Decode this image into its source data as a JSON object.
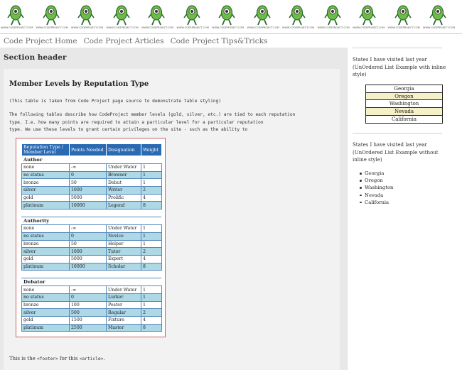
{
  "banner": {
    "logo_text": "WWW.CODEPROJECT.COM",
    "logo_count": 13
  },
  "nav": {
    "items": [
      "Code Project Home",
      "Code Project Articles",
      "Code Project Tips&Tricks"
    ]
  },
  "main": {
    "section_header": "Section header",
    "article_title": "Member Levels by Reputation Type",
    "note": "(This table is taken from Code Project page source to demonstrate table styling)",
    "description": [
      "The following tables describe how CodeProject member levels (gold, silver, etc.) are tied to each reputation",
      "type. I.e. how many points are required to attain a particular level for a particular reputation",
      "type. We use these levels to grant certain privileges on the site - such as the ability to"
    ],
    "footer": {
      "prefix": "This is the ",
      "code1": "<footer>",
      "middle": " for this ",
      "code2": "<article>",
      "suffix": "."
    }
  },
  "table": {
    "headers": [
      "Reputation Type / Member Level",
      "Points Needed",
      "Designation",
      "Weight"
    ],
    "groups": [
      {
        "name": "Author",
        "rows": [
          [
            "none",
            "-∞",
            "Under Water",
            "1"
          ],
          [
            "no status",
            "0",
            "Browser",
            "1"
          ],
          [
            "bronze",
            "50",
            "Debut",
            "1"
          ],
          [
            "silver",
            "1000",
            "Writer",
            "2"
          ],
          [
            "gold",
            "5000",
            "Prolific",
            "4"
          ],
          [
            "platinum",
            "10000",
            "Legend",
            "8"
          ]
        ]
      },
      {
        "name": "Authority",
        "rows": [
          [
            "none",
            "-∞",
            "Under Water",
            "1"
          ],
          [
            "no status",
            "0",
            "Novice",
            "1"
          ],
          [
            "bronze",
            "50",
            "Helper",
            "1"
          ],
          [
            "silver",
            "1000",
            "Tutor",
            "2"
          ],
          [
            "gold",
            "5000",
            "Expert",
            "4"
          ],
          [
            "platinum",
            "10000",
            "Scholar",
            "8"
          ]
        ]
      },
      {
        "name": "Debator",
        "rows": [
          [
            "none",
            "-∞",
            "Under Water",
            "1"
          ],
          [
            "no status",
            "0",
            "Lurker",
            "1"
          ],
          [
            "bronze",
            "100",
            "Poster",
            "1"
          ],
          [
            "silver",
            "500",
            "Regular",
            "2"
          ],
          [
            "gold",
            "1500",
            "Fixture",
            "4"
          ],
          [
            "platinum",
            "2500",
            "Master",
            "8"
          ]
        ]
      }
    ]
  },
  "sidebar": {
    "list1_title": "States I have visited last year (UnOrdered List Example with inline style)",
    "list1_items": [
      "Georgia",
      "Oregon",
      "Washington",
      "Nevada",
      "California"
    ],
    "list2_title": "States I have visited last year (UnOrdered List Example without inline style)",
    "list2_items": [
      "Georgia",
      "Oregon",
      "Washington",
      "Nevada",
      "California"
    ]
  },
  "colors": {
    "table_header": "#2a6ab3",
    "row_alt": "#add8e6",
    "frame_border": "#c86464",
    "list_alt": "#f5f0c8"
  }
}
